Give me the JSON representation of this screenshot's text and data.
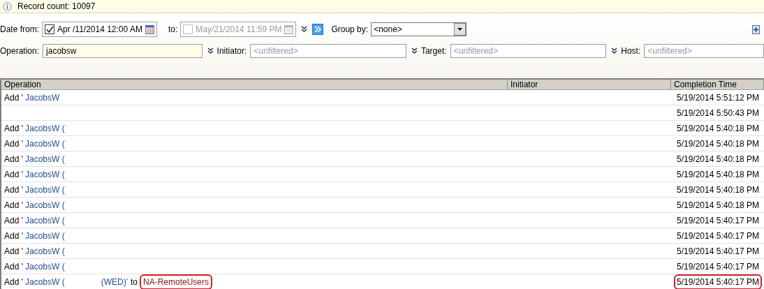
{
  "info_bar": {
    "text": "Record count: 10097"
  },
  "filters": {
    "date_from": {
      "label": "Date from:",
      "value": "Apr /11/2014 12:00 AM",
      "checked": true
    },
    "date_to": {
      "label": "to:",
      "value": "May/21/2014 11:59 PM",
      "checked": false
    },
    "group_by": {
      "label": "Group by:",
      "value": "<none>"
    },
    "operation": {
      "label": "Operation:",
      "value": "jacobsw"
    },
    "initiator": {
      "label": "Initiator:",
      "placeholder": "<unfiltered>"
    },
    "target": {
      "label": "Target:",
      "placeholder": "<unfiltered>"
    },
    "host": {
      "label": "Host:",
      "placeholder": "<unfiltered>"
    }
  },
  "table": {
    "columns": [
      "Operation",
      "Initiator",
      "Completion Time"
    ],
    "rows": [
      {
        "operation": [
          {
            "kind": "plain",
            "text": "Add '"
          },
          {
            "kind": "link",
            "text": "JacobsW"
          }
        ],
        "completion_time": "5/19/2014 5:51:12 PM",
        "circled": false
      },
      {
        "operation": [],
        "completion_time": "5/19/2014 5:50:43 PM",
        "circled": false
      },
      {
        "operation": [
          {
            "kind": "plain",
            "text": "Add '"
          },
          {
            "kind": "link",
            "text": "JacobsW ("
          }
        ],
        "completion_time": "5/19/2014 5:40:18 PM",
        "circled": false
      },
      {
        "operation": [
          {
            "kind": "plain",
            "text": "Add '"
          },
          {
            "kind": "link",
            "text": "JacobsW ("
          }
        ],
        "completion_time": "5/19/2014 5:40:18 PM",
        "circled": false
      },
      {
        "operation": [
          {
            "kind": "plain",
            "text": "Add '"
          },
          {
            "kind": "link",
            "text": "JacobsW ("
          }
        ],
        "completion_time": "5/19/2014 5:40:18 PM",
        "circled": false
      },
      {
        "operation": [
          {
            "kind": "plain",
            "text": "Add '"
          },
          {
            "kind": "link",
            "text": "JacobsW ("
          }
        ],
        "completion_time": "5/19/2014 5:40:18 PM",
        "circled": false
      },
      {
        "operation": [
          {
            "kind": "plain",
            "text": "Add '"
          },
          {
            "kind": "link",
            "text": "JacobsW ("
          }
        ],
        "completion_time": "5/19/2014 5:40:18 PM",
        "circled": false
      },
      {
        "operation": [
          {
            "kind": "plain",
            "text": "Add '"
          },
          {
            "kind": "link",
            "text": "JacobsW ("
          }
        ],
        "completion_time": "5/19/2014 5:40:18 PM",
        "circled": false
      },
      {
        "operation": [
          {
            "kind": "plain",
            "text": "Add '"
          },
          {
            "kind": "link",
            "text": "JacobsW ("
          }
        ],
        "completion_time": "5/19/2014 5:40:17 PM",
        "circled": false
      },
      {
        "operation": [
          {
            "kind": "plain",
            "text": "Add '"
          },
          {
            "kind": "link",
            "text": "JacobsW ("
          }
        ],
        "completion_time": "5/19/2014 5:40:17 PM",
        "circled": false
      },
      {
        "operation": [
          {
            "kind": "plain",
            "text": "Add '"
          },
          {
            "kind": "link",
            "text": "JacobsW ("
          }
        ],
        "completion_time": "5/19/2014 5:40:17 PM",
        "circled": false
      },
      {
        "operation": [
          {
            "kind": "plain",
            "text": "Add '"
          },
          {
            "kind": "link",
            "text": "JacobsW ("
          }
        ],
        "completion_time": "5/19/2014 5:40:17 PM",
        "circled": false
      },
      {
        "operation": [
          {
            "kind": "plain",
            "text": "Add '"
          },
          {
            "kind": "link",
            "text": "JacobsW ("
          },
          {
            "kind": "link_gap",
            "text": "(WED)'"
          },
          {
            "kind": "plain",
            "text": "to"
          },
          {
            "kind": "target",
            "text": "NA-RemoteUsers"
          }
        ],
        "completion_time": "5/19/2014 5:40:17 PM",
        "circled": true
      }
    ]
  }
}
